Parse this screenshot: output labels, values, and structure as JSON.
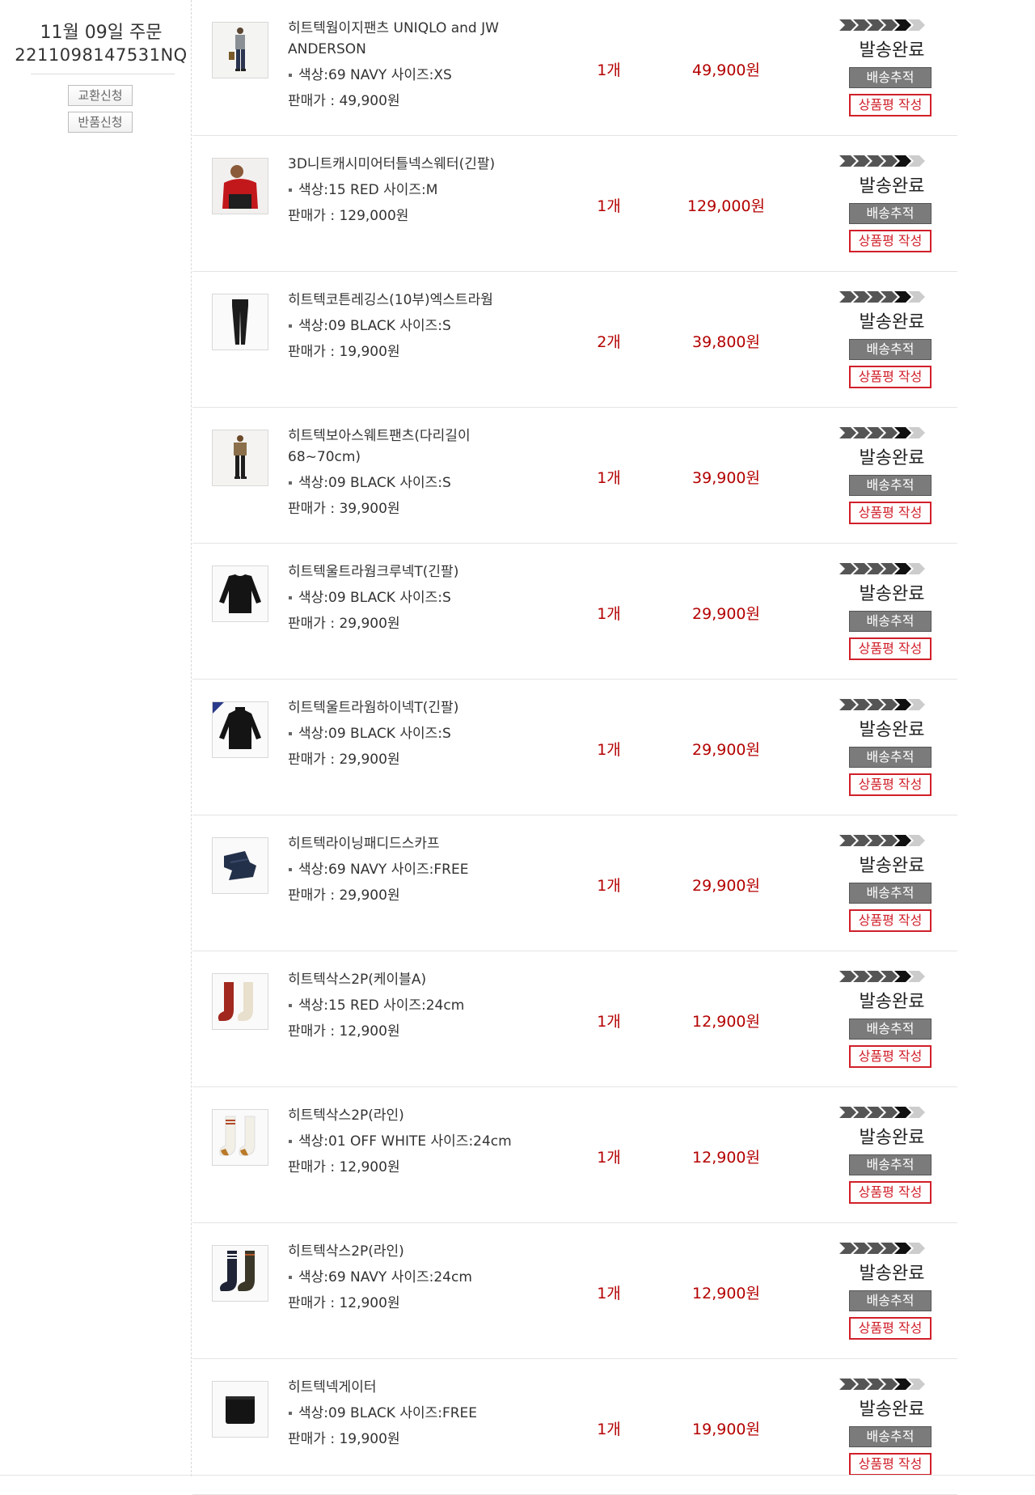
{
  "order": {
    "date": "11월 09일 주문",
    "number": "2211098147531NQ",
    "exchange_label": "교환신청",
    "return_label": "반품신청"
  },
  "labels": {
    "option_prefix": "색상:",
    "size_prefix": "사이즈:",
    "price_prefix": "판매가 : ",
    "status": "발송완료",
    "track": "배송추적",
    "review": "상품평 작성"
  },
  "items": [
    {
      "name": "히트텍웜이지팬츠 UNIQLO and JW ANDERSON",
      "option": "색상:69 NAVY 사이즈:XS",
      "price": "판매가 : 49,900원",
      "qty": "1개",
      "amount": "49,900원",
      "status": "발송완료",
      "track": "배송추적",
      "review": "상품평 작성",
      "icon": "model-pants-icon"
    },
    {
      "name": "3D니트캐시미어터틀넥스웨터(긴팔)",
      "option": "색상:15 RED 사이즈:M",
      "price": "판매가 : 129,000원",
      "qty": "1개",
      "amount": "129,000원",
      "status": "발송완료",
      "track": "배송추적",
      "review": "상품평 작성",
      "icon": "model-red-sweater-icon"
    },
    {
      "name": "히트텍코튼레깅스(10부)엑스트라웜",
      "option": "색상:09 BLACK 사이즈:S",
      "price": "판매가 : 19,900원",
      "qty": "2개",
      "amount": "39,800원",
      "status": "발송완료",
      "track": "배송추적",
      "review": "상품평 작성",
      "icon": "leggings-icon"
    },
    {
      "name": "히트텍보아스웨트팬츠(다리길이 68~70cm)",
      "option": "색상:09 BLACK 사이즈:S",
      "price": "판매가 : 39,900원",
      "qty": "1개",
      "amount": "39,900원",
      "status": "발송완료",
      "track": "배송추적",
      "review": "상품평 작성",
      "icon": "model-black-pants-icon"
    },
    {
      "name": "히트텍울트라웜크루넥T(긴팔)",
      "option": "색상:09 BLACK 사이즈:S",
      "price": "판매가 : 29,900원",
      "qty": "1개",
      "amount": "29,900원",
      "status": "발송완료",
      "track": "배송추적",
      "review": "상품평 작성",
      "icon": "crewneck-icon"
    },
    {
      "name": "히트텍울트라웜하이넥T(긴팔)",
      "option": "색상:09 BLACK 사이즈:S",
      "price": "판매가 : 29,900원",
      "qty": "1개",
      "amount": "29,900원",
      "status": "발송완료",
      "track": "배송추적",
      "review": "상품평 작성",
      "icon": "highneck-icon"
    },
    {
      "name": "히트텍라이닝패디드스카프",
      "option": "색상:69 NAVY 사이즈:FREE",
      "price": "판매가 : 29,900원",
      "qty": "1개",
      "amount": "29,900원",
      "status": "발송완료",
      "track": "배송추적",
      "review": "상품평 작성",
      "icon": "scarf-icon"
    },
    {
      "name": "히트텍삭스2P(케이블A)",
      "option": "색상:15 RED 사이즈:24cm",
      "price": "판매가 : 12,900원",
      "qty": "1개",
      "amount": "12,900원",
      "status": "발송완료",
      "track": "배송추적",
      "review": "상품평 작성",
      "icon": "red-socks-icon"
    },
    {
      "name": "히트텍삭스2P(라인)",
      "option": "색상:01 OFF WHITE 사이즈:24cm",
      "price": "판매가 : 12,900원",
      "qty": "1개",
      "amount": "12,900원",
      "status": "발송완료",
      "track": "배송추적",
      "review": "상품평 작성",
      "icon": "white-socks-icon"
    },
    {
      "name": "히트텍삭스2P(라인)",
      "option": "색상:69 NAVY 사이즈:24cm",
      "price": "판매가 : 12,900원",
      "qty": "1개",
      "amount": "12,900원",
      "status": "발송완료",
      "track": "배송추적",
      "review": "상품평 작성",
      "icon": "navy-socks-icon"
    },
    {
      "name": "히트텍넥게이터",
      "option": "색상:09 BLACK 사이즈:FREE",
      "price": "판매가 : 19,900원",
      "qty": "1개",
      "amount": "19,900원",
      "status": "발송완료",
      "track": "배송추적",
      "review": "상품평 작성",
      "icon": "neck-gaiter-icon"
    }
  ],
  "colors": {
    "accent_red": "#b40000",
    "review_border": "#d0202a",
    "track_bg": "#7b7b7b"
  }
}
